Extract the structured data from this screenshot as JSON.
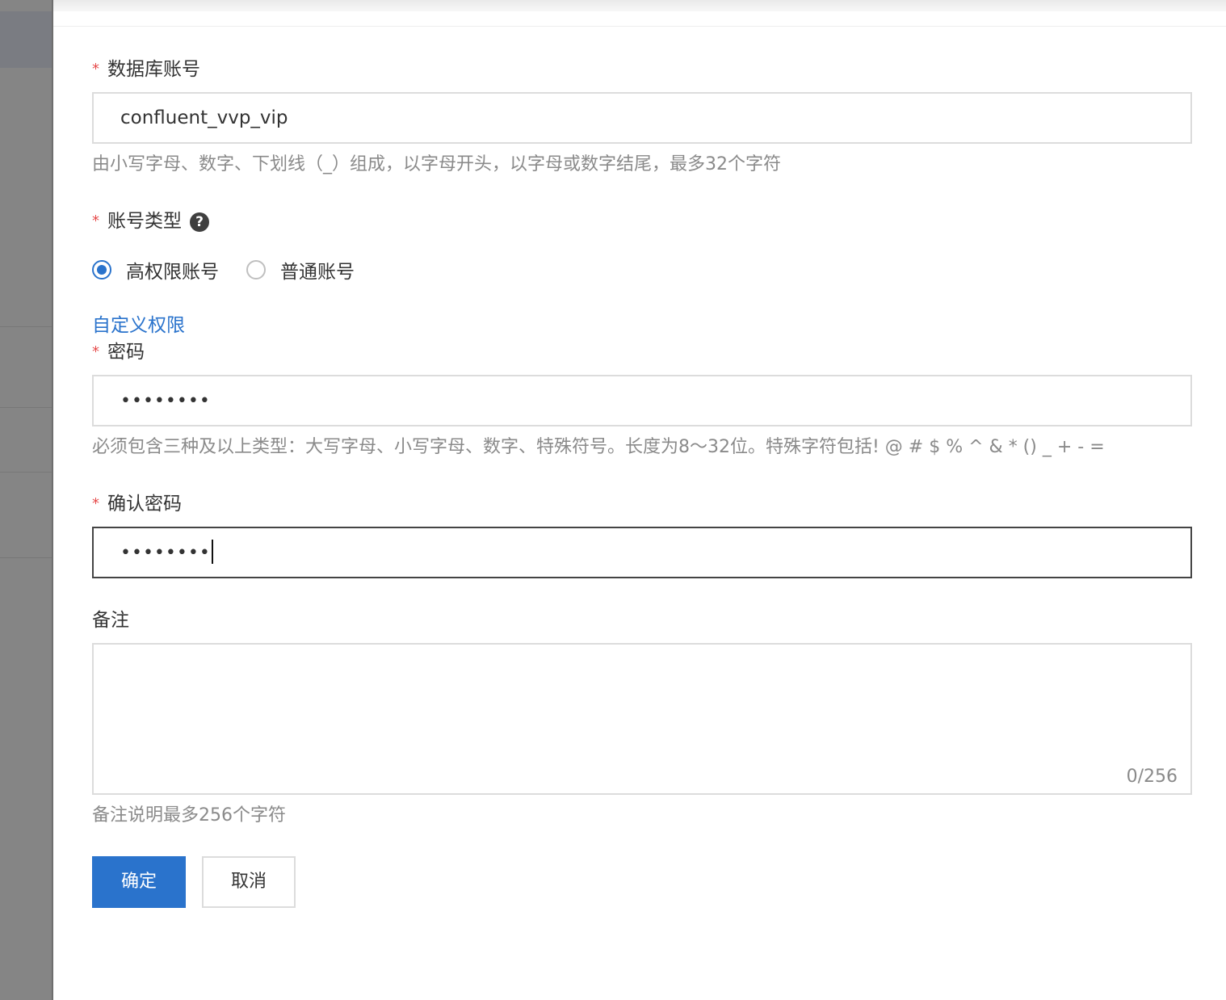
{
  "form": {
    "account": {
      "required": "*",
      "label": "数据库账号",
      "value": "confluent_vvp_vip",
      "hint": "由小写字母、数字、下划线（_）组成，以字母开头，以字母或数字结尾，最多32个字符"
    },
    "account_type": {
      "required": "*",
      "label": "账号类型",
      "help": "?",
      "options": [
        {
          "label": "高权限账号",
          "selected": true
        },
        {
          "label": "普通账号",
          "selected": false
        }
      ]
    },
    "custom_permissions_link": "自定义权限",
    "password": {
      "required": "*",
      "label": "密码",
      "value": "••••••••",
      "hint": "必须包含三种及以上类型：大写字母、小写字母、数字、特殊符号。长度为8～32位。特殊字符包括! @ # $ % ^ & * () _ + - ="
    },
    "confirm_password": {
      "required": "*",
      "label": "确认密码",
      "value": "••••••••"
    },
    "remark": {
      "label": "备注",
      "counter": "0/256",
      "hint": "备注说明最多256个字符"
    },
    "buttons": {
      "confirm": "确定",
      "cancel": "取消"
    }
  },
  "colors": {
    "primary": "#2a73cc",
    "required": "#e64a4a",
    "hint": "#8a8a8a"
  }
}
